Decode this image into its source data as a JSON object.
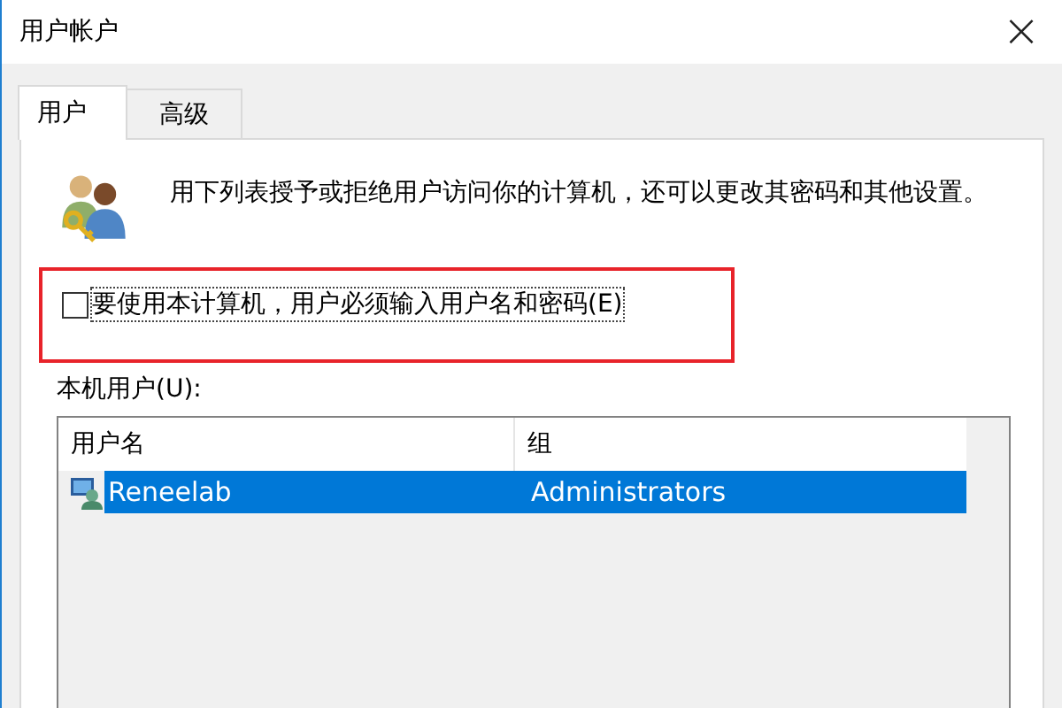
{
  "window": {
    "title": "用户帐户",
    "close": "×"
  },
  "tabs": [
    {
      "label": "用户",
      "selected": true
    },
    {
      "label": "高级",
      "selected": false
    }
  ],
  "description": "用下列表授予或拒绝用户访问你的计算机，还可以更改其密码和其他设置。",
  "require_password": {
    "label": "要使用本计算机，用户必须输入用户名和密码(E)",
    "checked": false,
    "highlighted": true
  },
  "users_label": "本机用户(U):",
  "table": {
    "columns": [
      "用户名",
      "组"
    ],
    "rows": [
      {
        "cells": [
          "Reneelab",
          "Administrators"
        ],
        "selected": true
      }
    ]
  }
}
